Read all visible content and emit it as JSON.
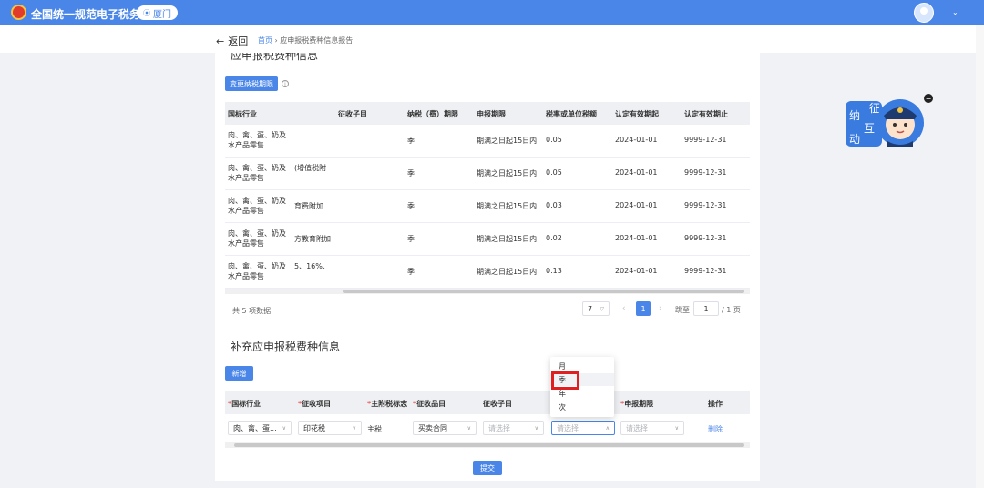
{
  "header": {
    "app_title": "全国统一规范电子税务局",
    "city": "厦门",
    "user_menu_chevron": "⌄"
  },
  "nav": {
    "back_label": "返回",
    "breadcrumb_home": "首页",
    "breadcrumb_sep": "›",
    "breadcrumb_current": "应申报税费种信息报告"
  },
  "section1": {
    "title": "应申报税费种信息",
    "change_button": "变更纳税期限",
    "columns": [
      "国标行业",
      "征收子目",
      "纳税（费）期限",
      "申报期限",
      "税率或单位税额",
      "认定有效期起",
      "认定有效期止"
    ],
    "rows": [
      {
        "industry": "肉、禽、蛋、奶及水产品零售",
        "sub_item": "",
        "period": "季",
        "deadline": "期满之日起15日内",
        "rate": "0.05",
        "valid_from": "2024-01-01",
        "valid_to": "9999-12-31"
      },
      {
        "industry": "肉、禽、蛋、奶及水产品零售",
        "sub_item": "(增值税附",
        "period": "季",
        "deadline": "期满之日起15日内",
        "rate": "0.05",
        "valid_from": "2024-01-01",
        "valid_to": "9999-12-31"
      },
      {
        "industry": "肉、禽、蛋、奶及水产品零售",
        "sub_item": "育费附加",
        "period": "季",
        "deadline": "期满之日起15日内",
        "rate": "0.03",
        "valid_from": "2024-01-01",
        "valid_to": "9999-12-31"
      },
      {
        "industry": "肉、禽、蛋、奶及水产品零售",
        "sub_item": "方教育附加",
        "period": "季",
        "deadline": "期满之日起15日内",
        "rate": "0.02",
        "valid_from": "2024-01-01",
        "valid_to": "9999-12-31"
      },
      {
        "industry": "肉、禽、蛋、奶及水产品零售",
        "sub_item": "5、16%、",
        "period": "季",
        "deadline": "期满之日起15日内",
        "rate": "0.13",
        "valid_from": "2024-01-01",
        "valid_to": "9999-12-31"
      }
    ],
    "pagination": {
      "total_text": "共 5 项数据",
      "page_size": "7",
      "current_page": "1",
      "jump_label": "跳至",
      "jump_value": "1",
      "total_pages": "/ 1 页"
    }
  },
  "section2": {
    "title": "补充应申报税费种信息",
    "add_button": "新增",
    "columns": [
      {
        "label": "国标行业",
        "required": "*"
      },
      {
        "label": "征收项目",
        "required": "*"
      },
      {
        "label": "主附税标志",
        "required": "*"
      },
      {
        "label": "征收品目",
        "required": "*"
      },
      {
        "label": "征收子目",
        "required": ""
      },
      {
        "label": "",
        "required": ""
      },
      {
        "label": "申报期限",
        "required": "*"
      },
      {
        "label": "操作",
        "required": ""
      }
    ],
    "row": {
      "industry": "肉、禽、蛋...",
      "project": "印花税",
      "main_flag": "主税",
      "item": "买卖合同",
      "sub_item_placeholder": "请选择",
      "period_placeholder": "请选择",
      "deadline_placeholder": "请选择",
      "delete_label": "删除"
    },
    "submit_button": "提交"
  },
  "period_dropdown": {
    "options": [
      "月",
      "季",
      "年",
      "次"
    ],
    "highlighted": "季"
  },
  "mascot": {
    "lettering": "征纳互动",
    "close_label": "−"
  },
  "colors": {
    "primary": "#4a86e8",
    "header_bg": "#4a86e8",
    "required_mark": "#e34d4d",
    "highlight_box": "#e02020"
  }
}
